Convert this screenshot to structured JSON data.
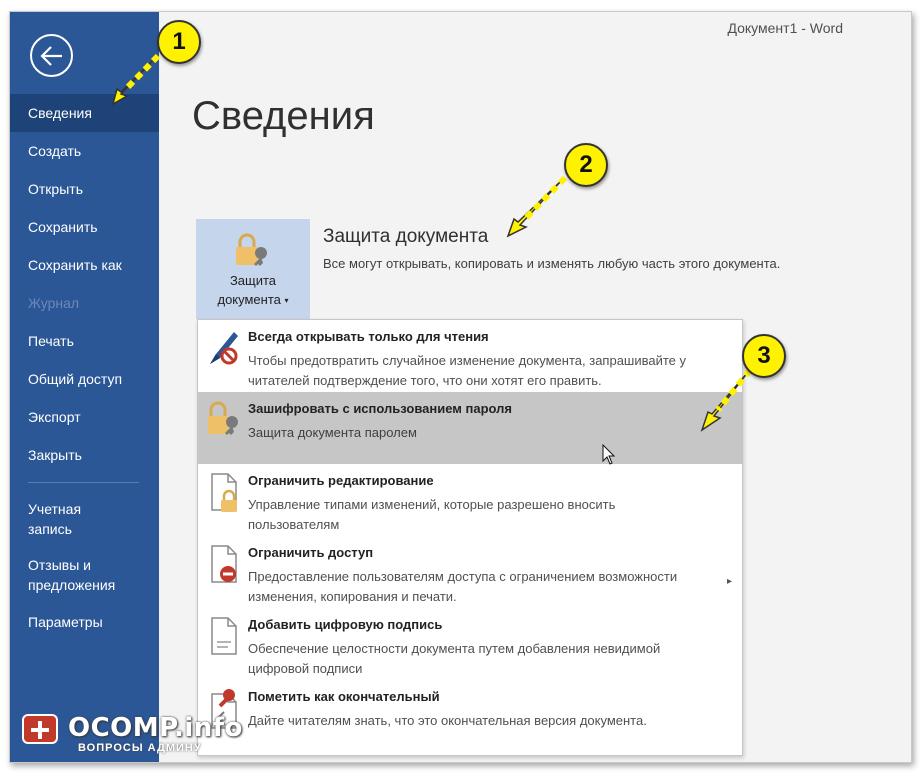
{
  "window": {
    "title": "Документ1  -  Word"
  },
  "sidebar": {
    "items": [
      {
        "label": "Сведения",
        "state": "active"
      },
      {
        "label": "Создать",
        "state": "normal"
      },
      {
        "label": "Открыть",
        "state": "normal"
      },
      {
        "label": "Сохранить",
        "state": "normal"
      },
      {
        "label": "Сохранить как",
        "state": "normal"
      },
      {
        "label": "Журнал",
        "state": "disabled"
      },
      {
        "label": "Печать",
        "state": "normal"
      },
      {
        "label": "Общий доступ",
        "state": "normal"
      },
      {
        "label": "Экспорт",
        "state": "normal"
      },
      {
        "label": "Закрыть",
        "state": "normal"
      }
    ],
    "account": {
      "line1": "Учетная",
      "line2": "запись"
    },
    "feedback": {
      "line1": "Отзывы и",
      "line2": "предложения"
    },
    "options": "Параметры"
  },
  "main": {
    "title": "Сведения",
    "protect_button": {
      "line1": "Защита",
      "line2": "документа",
      "caret": "▾"
    },
    "section_title": "Защита документа",
    "section_desc": "Все могут открывать, копировать и изменять любую часть этого документа."
  },
  "menu": {
    "items": [
      {
        "title": "Всегда открывать только для чтения",
        "desc": "Чтобы предотвратить случайное изменение документа, запрашивайте у читателей подтверждение того, что они хотят его править.",
        "icon": "pen-no-icon"
      },
      {
        "title": "Зашифровать с использованием пароля",
        "desc": "Защита документа паролем",
        "icon": "lock-key-icon",
        "highlighted": true
      },
      {
        "title": "Ограничить редактирование",
        "desc": "Управление типами изменений, которые разрешено вносить пользователям",
        "icon": "doc-lock-icon"
      },
      {
        "title": "Ограничить доступ",
        "desc": "Предоставление пользователям доступа с ограничением возможности изменения, копирования и печати.",
        "icon": "doc-restrict-icon",
        "submenu": "▸"
      },
      {
        "title": "Добавить цифровую подпись",
        "desc": "Обеспечение целостности документа путем добавления невидимой цифровой подписи",
        "icon": "doc-ribbon-icon"
      },
      {
        "title": "Пометить как окончательный",
        "desc": "Дайте читателям знать, что это окончательная версия документа.",
        "icon": "doc-final-icon"
      }
    ]
  },
  "annotations": {
    "badge1": "1",
    "badge2": "2",
    "badge3": "3"
  },
  "watermark": {
    "main": "OCOMP.info",
    "sub": "ВОПРОСЫ АДМИНУ"
  },
  "colors": {
    "sidebar": "#2b5797",
    "sidebar_active": "#1e4378",
    "badge": "#fff200",
    "highlight": "#c6c6c6"
  }
}
